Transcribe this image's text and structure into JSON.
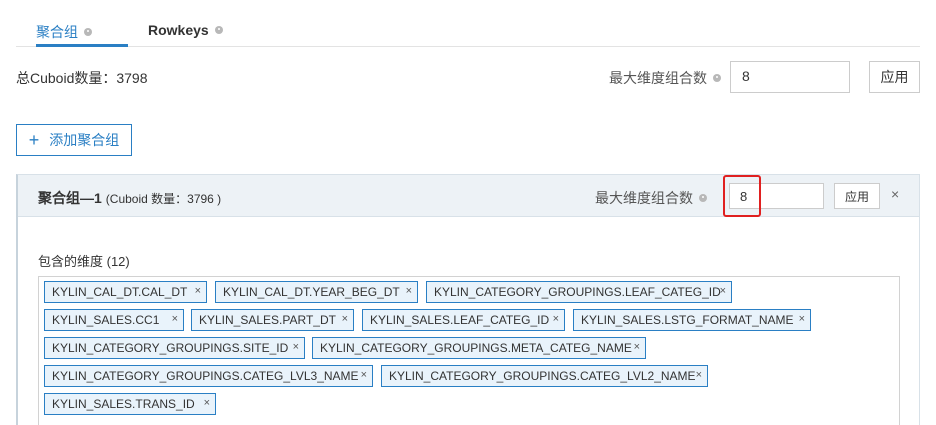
{
  "tabs": [
    {
      "label": "聚合组",
      "active": true
    },
    {
      "label": "Rowkeys",
      "active": false
    }
  ],
  "summary": {
    "total_label": "总Cuboid数量：3798"
  },
  "top_controls": {
    "max_label": "最大维度组合数",
    "max_value": "8",
    "apply_label": "应用"
  },
  "add_group": {
    "icon": "plus-icon",
    "label": "添加聚合组"
  },
  "group": {
    "title": "聚合组—1",
    "cuboid_count": "(Cuboid 数量：3796 )",
    "max_label": "最大维度组合数",
    "max_value": "8",
    "apply_label": "应用",
    "close_icon": "close-icon",
    "dims_label": "包含的维度 (12)",
    "highlight_color": "#e02020"
  },
  "dimensions": [
    "KYLIN_CAL_DT.CAL_DT",
    "KYLIN_CAL_DT.YEAR_BEG_DT",
    "KYLIN_CATEGORY_GROUPINGS.LEAF_CATEG_ID",
    "KYLIN_SALES.CC1",
    "KYLIN_SALES.PART_DT",
    "KYLIN_SALES.LEAF_CATEG_ID",
    "KYLIN_SALES.LSTG_FORMAT_NAME",
    "KYLIN_CATEGORY_GROUPINGS.SITE_ID",
    "KYLIN_CATEGORY_GROUPINGS.META_CATEG_NAME",
    "KYLIN_CATEGORY_GROUPINGS.CATEG_LVL3_NAME",
    "KYLIN_CATEGORY_GROUPINGS.CATEG_LVL2_NAME",
    "KYLIN_SALES.TRANS_ID"
  ],
  "tag_remove_glyph": "×",
  "colors": {
    "accent": "#2a7fc4",
    "tag_bg": "#e9f3fb"
  }
}
